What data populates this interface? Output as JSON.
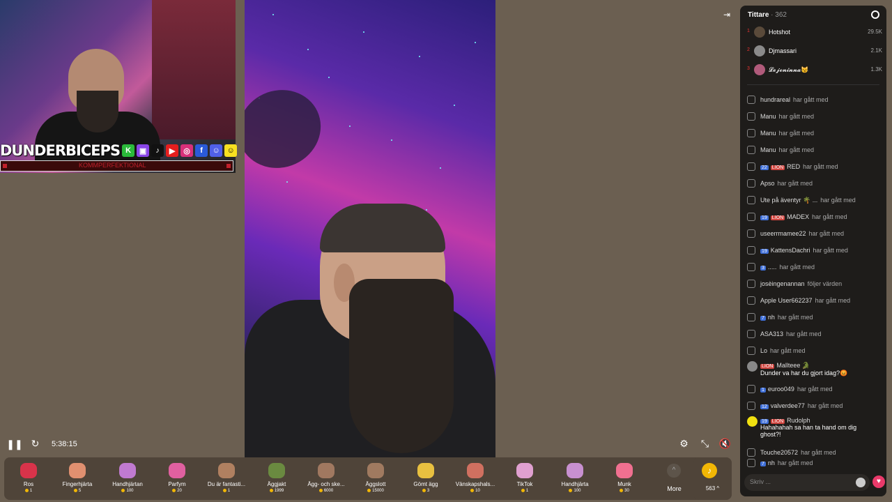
{
  "stream": {
    "streamer_name": "DUNDERBICEPS",
    "banner_text": "KOMMPERFEKTIONAL",
    "elapsed_time": "5:38:15",
    "social_badges": [
      "K",
      "twitch",
      "tiktok",
      "youtube",
      "instagram",
      "facebook",
      "discord",
      "snapchat"
    ]
  },
  "gifts": [
    {
      "name": "Ros",
      "price": "1",
      "color": "#d8334a"
    },
    {
      "name": "Fingerhjärta",
      "price": "5",
      "color": "#e09070"
    },
    {
      "name": "Handhjärtan",
      "price": "100",
      "color": "#c07ad0"
    },
    {
      "name": "Parfym",
      "price": "20",
      "color": "#e060a0"
    },
    {
      "name": "Du är fantasti...",
      "price": "1",
      "color": "#b08060"
    },
    {
      "name": "Äggjakt",
      "price": "1999",
      "color": "#6a8a40"
    },
    {
      "name": "Ägg- och ske...",
      "price": "6000",
      "color": "#a07860"
    },
    {
      "name": "Äggslott",
      "price": "15000",
      "color": "#a07a60"
    },
    {
      "name": "Gömt ägg",
      "price": "3",
      "color": "#e8c040"
    },
    {
      "name": "Vänskapshals...",
      "price": "10",
      "color": "#d07060"
    },
    {
      "name": "TikTok",
      "price": "1",
      "color": "#e0a0d0"
    },
    {
      "name": "Handhjärta",
      "price": "100",
      "color": "#c890d0"
    },
    {
      "name": "Munk",
      "price": "30",
      "color": "#f07090"
    }
  ],
  "more_label": "More",
  "coin_balance": "563",
  "panel": {
    "title": "Tittare",
    "viewer_count": "· 362",
    "top_viewers": [
      {
        "rank": "1",
        "name": "Hotshot",
        "value": "29.5K"
      },
      {
        "rank": "2",
        "name": "Djmassari",
        "value": "2.1K"
      },
      {
        "rank": "3",
        "name": "𝓛𝓮𝓳𝓸𝓷𝓲𝓷𝓷𝓪😼",
        "value": "1.3K"
      }
    ],
    "messages": [
      {
        "user": "hundrareal",
        "action": "har gått med",
        "badges": []
      },
      {
        "user": "Manu",
        "action": "har gått med",
        "badges": []
      },
      {
        "user": "Manu",
        "action": "har gått med",
        "badges": []
      },
      {
        "user": "Manu",
        "action": "har gått med",
        "badges": []
      },
      {
        "user": "RED",
        "action": "har gått med",
        "badges": [
          {
            "t": "22",
            "c": "b"
          },
          {
            "t": "LION",
            "c": "r"
          }
        ]
      },
      {
        "user": "Apso",
        "action": "har gått med",
        "badges": []
      },
      {
        "user": "Ute på äventyr 🌴 ...",
        "action": "har gått med",
        "badges": []
      },
      {
        "user": "MADEX",
        "action": "har gått med",
        "badges": [
          {
            "t": "19",
            "c": "b"
          },
          {
            "t": "LION",
            "c": "r"
          }
        ]
      },
      {
        "user": "useerrmamee22",
        "action": "har gått med",
        "badges": []
      },
      {
        "user": "KattensDachri",
        "action": "har gått med",
        "badges": [
          {
            "t": "19",
            "c": "b"
          }
        ]
      },
      {
        "user": ".....",
        "action": "har gått med",
        "badges": [
          {
            "t": "3",
            "c": "b"
          }
        ]
      },
      {
        "user": "josèingenannan",
        "action": "följer värden",
        "badges": []
      },
      {
        "user": "Apple User662237",
        "action": "har gått med",
        "badges": []
      },
      {
        "user": "nh",
        "action": "har gått med",
        "badges": [
          {
            "t": "7",
            "c": "b"
          }
        ]
      },
      {
        "user": "ASA313",
        "action": "har gått med",
        "badges": []
      },
      {
        "user": "Lo",
        "action": "har gått med",
        "badges": []
      },
      {
        "user": "Mallteee 🐊",
        "action": "Dunder va har du gjort idag?😡",
        "badges": [
          {
            "t": "LION",
            "c": "r"
          }
        ],
        "chat": true
      },
      {
        "user": "euroo049",
        "action": "har gått med",
        "badges": [
          {
            "t": "1",
            "c": "b"
          }
        ]
      },
      {
        "user": "valverdee77",
        "action": "har gått med",
        "badges": [
          {
            "t": "12",
            "c": "b"
          }
        ]
      },
      {
        "user": "Rudolph",
        "action": "Hahahahah sa han ta hand om dig ghost?!",
        "badges": [
          {
            "t": "19",
            "c": "b"
          },
          {
            "t": "LION",
            "c": "r"
          }
        ],
        "chat": true
      },
      {
        "user": "Touche20572",
        "action": "har gått med",
        "badges": []
      },
      {
        "user": "nh",
        "action": "har gått med",
        "badges": [
          {
            "t": "7",
            "c": "b"
          }
        ]
      }
    ],
    "chat_placeholder": "Skriv ..."
  }
}
